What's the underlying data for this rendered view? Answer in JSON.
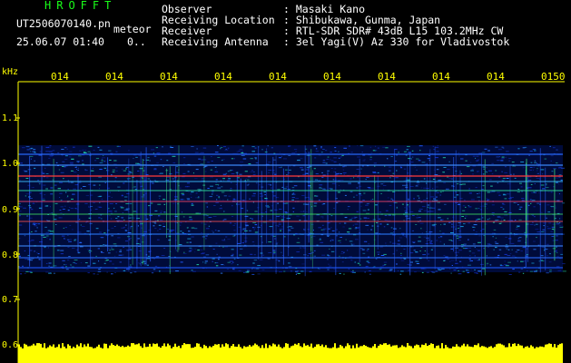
{
  "header": {
    "brand": "HROFFT",
    "filename": "UT2506070140.pn",
    "tag": "meteor",
    "datetime": "25.06.07 01:40",
    "counter": "0..",
    "rows": [
      {
        "label": "Observer",
        "value": ": Masaki Kano"
      },
      {
        "label": "Receiving Location",
        "value": ": Shibukawa, Gunma, Japan"
      },
      {
        "label": "Receiver",
        "value": ": RTL-SDR SDR# 43dB L15 103.2MHz CW"
      },
      {
        "label": "Receiving Antenna",
        "value": ": 3el Yagi(V) Az 330 for Vladivostok"
      }
    ]
  },
  "axis": {
    "unit": "kHz",
    "y_ticks": [
      "1.1",
      "1.0",
      "0.9",
      "0.8",
      "0.7",
      "0.6"
    ],
    "x_ticks": [
      "014",
      "014",
      "014",
      "014",
      "014",
      "014",
      "014",
      "014",
      "014",
      "0150"
    ]
  },
  "colors": {
    "background": "#000000",
    "axis": "#ffff00",
    "brand": "#19ff19",
    "text": "#ffffff"
  }
}
